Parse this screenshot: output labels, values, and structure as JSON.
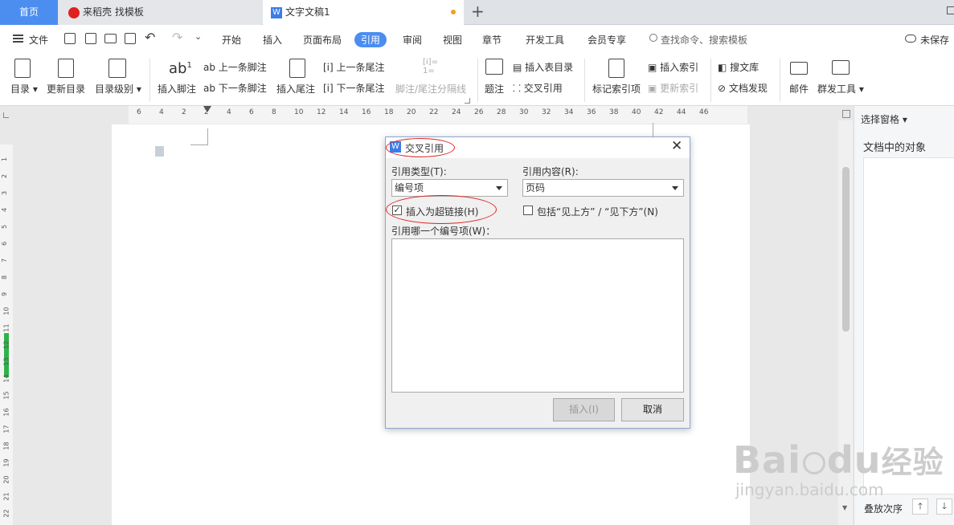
{
  "tabs": {
    "home": "首页",
    "daoke": "来稻壳 找模板",
    "doc": "文字文稿1"
  },
  "menu": {
    "file": "文件",
    "items": [
      "开始",
      "插入",
      "页面布局",
      "引用",
      "审阅",
      "视图",
      "章节",
      "开发工具",
      "会员专享"
    ],
    "search": "查找命令、搜索模板",
    "unsaved": "未保存"
  },
  "toolbar": {
    "toc": "目录",
    "update_toc": "更新目录",
    "toc_level": "目录级别",
    "insert_footnote": "插入脚注",
    "prev_footnote": "上一条脚注",
    "next_footnote": "下一条脚注",
    "insert_endnote": "插入尾注",
    "prev_endnote": "上一条尾注",
    "next_endnote": "下一条尾注",
    "separator": "脚注/尾注分隔线",
    "caption": "题注",
    "insert_figure_toc": "插入表目录",
    "cross_ref": "交叉引用",
    "mark_index": "标记索引项",
    "insert_index": "插入索引",
    "update_index": "更新索引",
    "search_library": "搜文库",
    "doc_discover": "文档发现",
    "mail": "邮件",
    "mass_mail": "群发工具"
  },
  "ruler": {
    "h": [
      "6",
      "4",
      "2",
      "2",
      "4",
      "6",
      "8",
      "10",
      "12",
      "14",
      "16",
      "18",
      "20",
      "22",
      "24",
      "26",
      "28",
      "30",
      "32",
      "34",
      "36",
      "38",
      "40",
      "42",
      "44",
      "46"
    ],
    "v": [
      "1",
      "2",
      "3",
      "4",
      "5",
      "6",
      "7",
      "8",
      "9",
      "10",
      "11",
      "12",
      "13",
      "14",
      "15",
      "16",
      "17",
      "18",
      "19",
      "20",
      "21",
      "22"
    ]
  },
  "side_panel": {
    "title": "选择窗格",
    "objects": "文档中的对象",
    "stack_order": "叠放次序"
  },
  "dialog": {
    "title": "交叉引用",
    "ref_type_label": "引用类型(T):",
    "ref_type_value": "编号项",
    "ref_content_label": "引用内容(R):",
    "ref_content_value": "页码",
    "hyperlink_label": "插入为超链接(H)",
    "hyperlink_checked": true,
    "above_below_label": "包括“见上方” / “见下方”(N)",
    "above_below_checked": false,
    "which_label": "引用哪一个编号项(W)：",
    "insert_btn": "插入(I)",
    "cancel_btn": "取消"
  },
  "watermark": {
    "brand": "Bai",
    "brand2": "du",
    "cn": "经验",
    "url": "jingyan.baidu.com"
  }
}
